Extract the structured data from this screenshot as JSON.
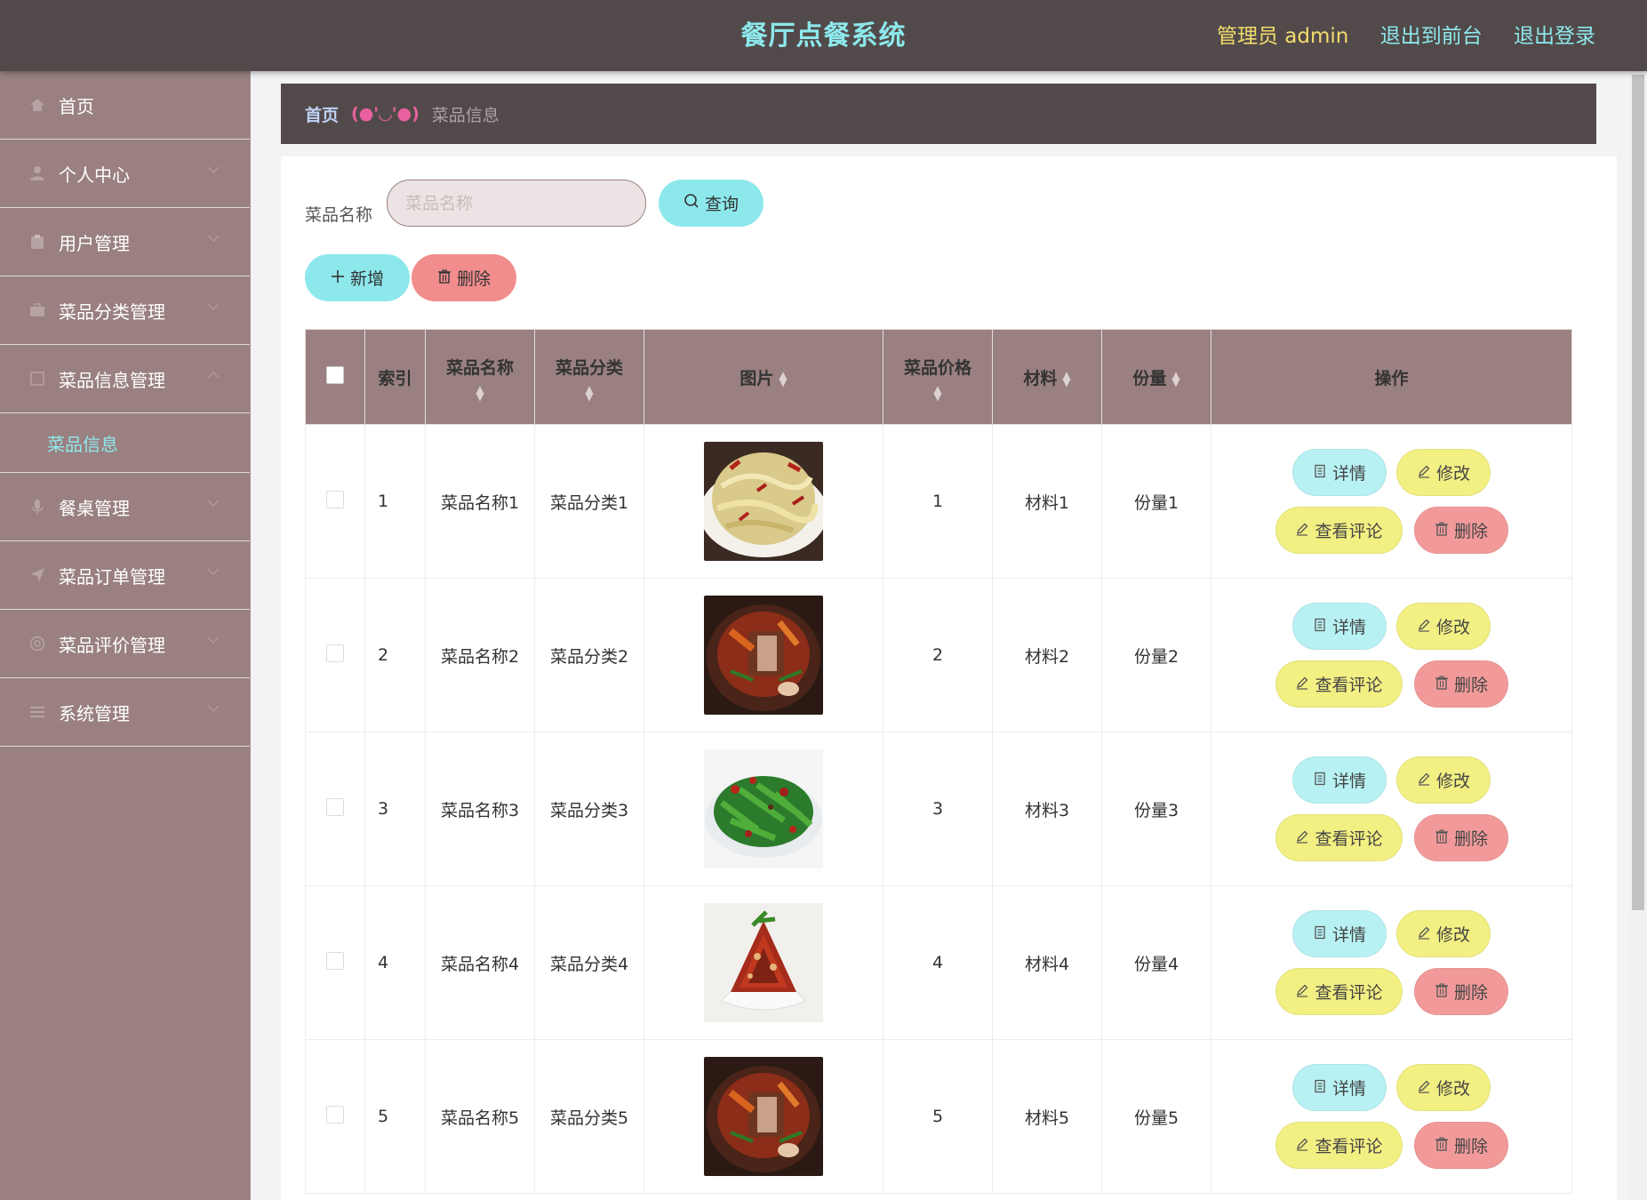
{
  "header": {
    "title": "餐厅点餐系统",
    "admin_label": "管理员 admin",
    "to_front_label": "退出到前台",
    "logout_label": "退出登录"
  },
  "sidebar": {
    "items": [
      {
        "label": "首页",
        "icon": "home-icon",
        "expandable": false
      },
      {
        "label": "个人中心",
        "icon": "user-icon",
        "expandable": true
      },
      {
        "label": "用户管理",
        "icon": "clipboard-icon",
        "expandable": true
      },
      {
        "label": "菜品分类管理",
        "icon": "briefcase-icon",
        "expandable": true
      },
      {
        "label": "菜品信息管理",
        "icon": "square-icon",
        "expandable": true,
        "expanded": true
      },
      {
        "label": "餐桌管理",
        "icon": "microphone-icon",
        "expandable": true
      },
      {
        "label": "菜品订单管理",
        "icon": "send-icon",
        "expandable": true
      },
      {
        "label": "菜品评价管理",
        "icon": "circle-icon",
        "expandable": true
      },
      {
        "label": "系统管理",
        "icon": "list-icon",
        "expandable": true
      }
    ],
    "submenu": {
      "label": "菜品信息"
    }
  },
  "breadcrumb": {
    "home": "首页",
    "separator": "(●'◡'●)",
    "current": "菜品信息"
  },
  "search": {
    "label": "菜品名称",
    "placeholder": "菜品名称",
    "value": "",
    "query_button": "查询"
  },
  "toolbar": {
    "add_label": "新增",
    "delete_label": "删除"
  },
  "table": {
    "columns": [
      "索引",
      "菜品名称",
      "菜品分类",
      "图片",
      "菜品价格",
      "材料",
      "份量",
      "操作"
    ],
    "rows": [
      {
        "index": "1",
        "name": "菜品名称1",
        "category": "菜品分类1",
        "image": "cabbage",
        "price": "1",
        "material": "材料1",
        "portion": "份量1"
      },
      {
        "index": "2",
        "name": "菜品名称2",
        "category": "菜品分类2",
        "image": "pot",
        "price": "2",
        "material": "材料2",
        "portion": "份量2"
      },
      {
        "index": "3",
        "name": "菜品名称3",
        "category": "菜品分类3",
        "image": "greens",
        "price": "3",
        "material": "材料3",
        "portion": "份量3"
      },
      {
        "index": "4",
        "name": "菜品名称4",
        "category": "菜品分类4",
        "image": "chili",
        "price": "4",
        "material": "材料4",
        "portion": "份量4"
      },
      {
        "index": "5",
        "name": "菜品名称5",
        "category": "菜品分类5",
        "image": "pot",
        "price": "5",
        "material": "材料5",
        "portion": "份量5"
      }
    ],
    "actions": {
      "detail": "详情",
      "edit": "修改",
      "comments": "查看评论",
      "delete": "删除"
    }
  },
  "colors": {
    "topbar": "#524a4a",
    "sidebar": "#9a8080",
    "accent_cyan": "#8de8ec",
    "accent_yellow": "#f2ef83",
    "accent_red": "#f28d8d"
  }
}
